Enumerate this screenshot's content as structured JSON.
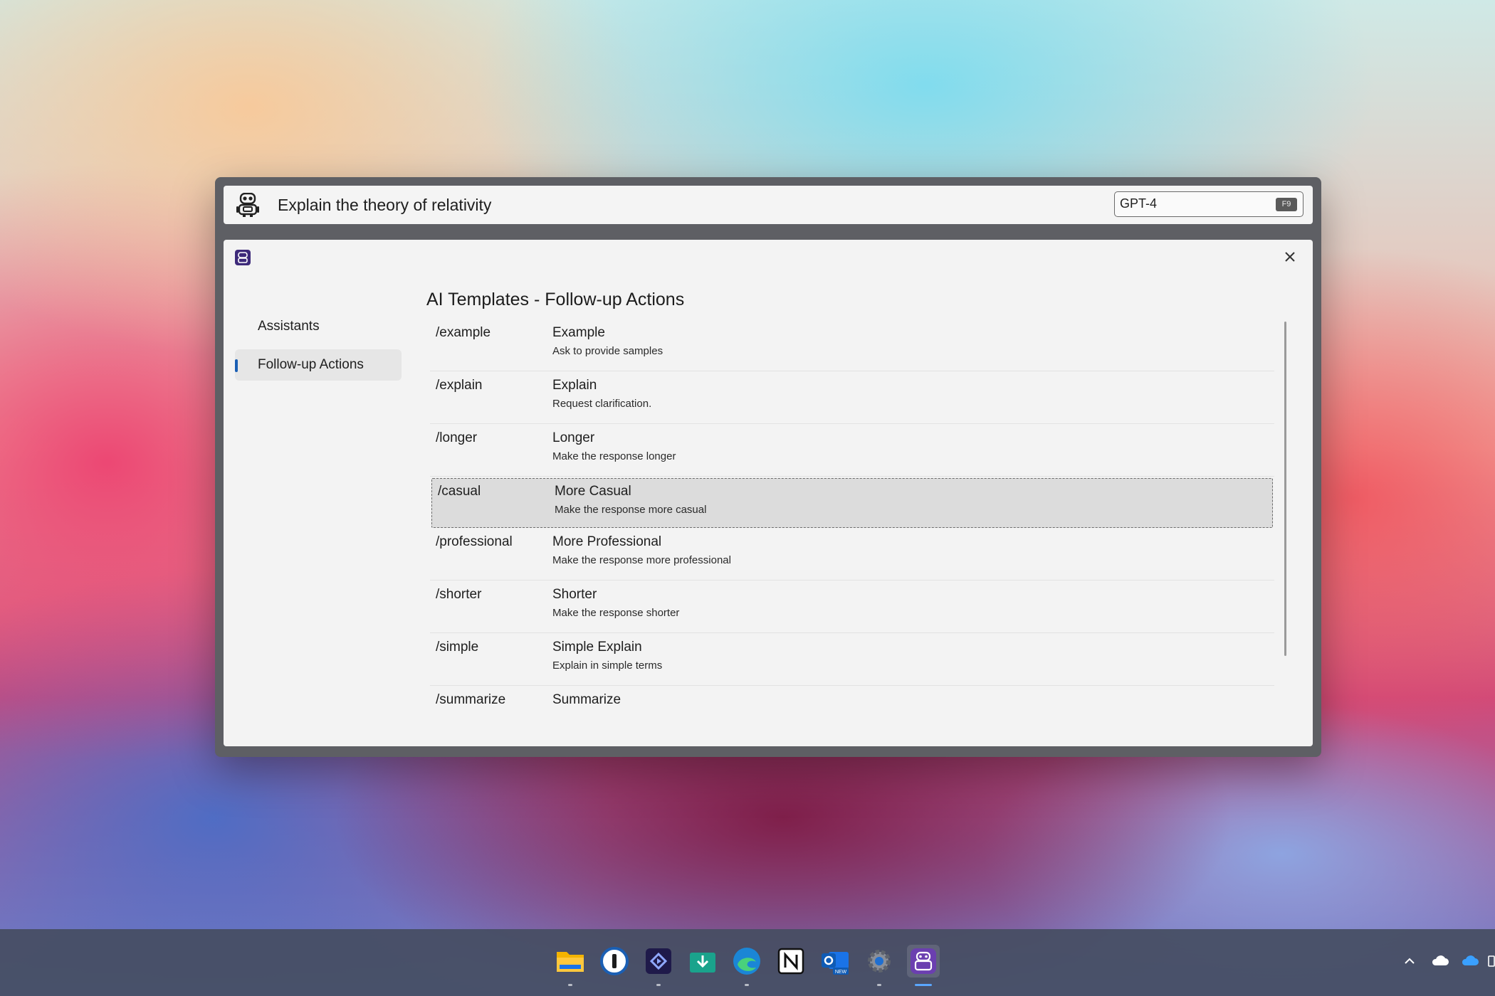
{
  "prompt": {
    "text": "Explain the theory of relativity"
  },
  "model": {
    "value": "GPT-4",
    "shortcut": "F9"
  },
  "nav": {
    "items": [
      {
        "label": "Assistants",
        "active": false
      },
      {
        "label": "Follow-up Actions",
        "active": true
      }
    ]
  },
  "section": {
    "title": "AI Templates - Follow-up Actions"
  },
  "rows": [
    {
      "command": "/example",
      "title": "Example",
      "desc": "Ask to provide samples"
    },
    {
      "command": "/explain",
      "title": "Explain",
      "desc": "Request clarification."
    },
    {
      "command": "/longer",
      "title": "Longer",
      "desc": "Make the response longer"
    },
    {
      "command": "/casual",
      "title": "More Casual",
      "desc": "Make the response more casual",
      "selected": true
    },
    {
      "command": "/professional",
      "title": "More Professional",
      "desc": "Make the response more professional"
    },
    {
      "command": "/shorter",
      "title": "Shorter",
      "desc": "Make the response shorter"
    },
    {
      "command": "/simple",
      "title": "Simple Explain",
      "desc": "Explain in simple terms"
    },
    {
      "command": "/summarize",
      "title": "Summarize",
      "desc": ""
    }
  ],
  "taskbar": {
    "icons": [
      "file-explorer-icon",
      "password-manager-icon",
      "video-editor-icon",
      "downloads-icon",
      "edge-browser-icon",
      "notion-icon",
      "outlook-icon",
      "settings-icon",
      "ai-assistant-icon"
    ],
    "new_badge": "NEW"
  },
  "colors": {
    "accent": "#1a5fb4",
    "panel": "#f3f3f3",
    "window_frame": "#5e5f64"
  }
}
